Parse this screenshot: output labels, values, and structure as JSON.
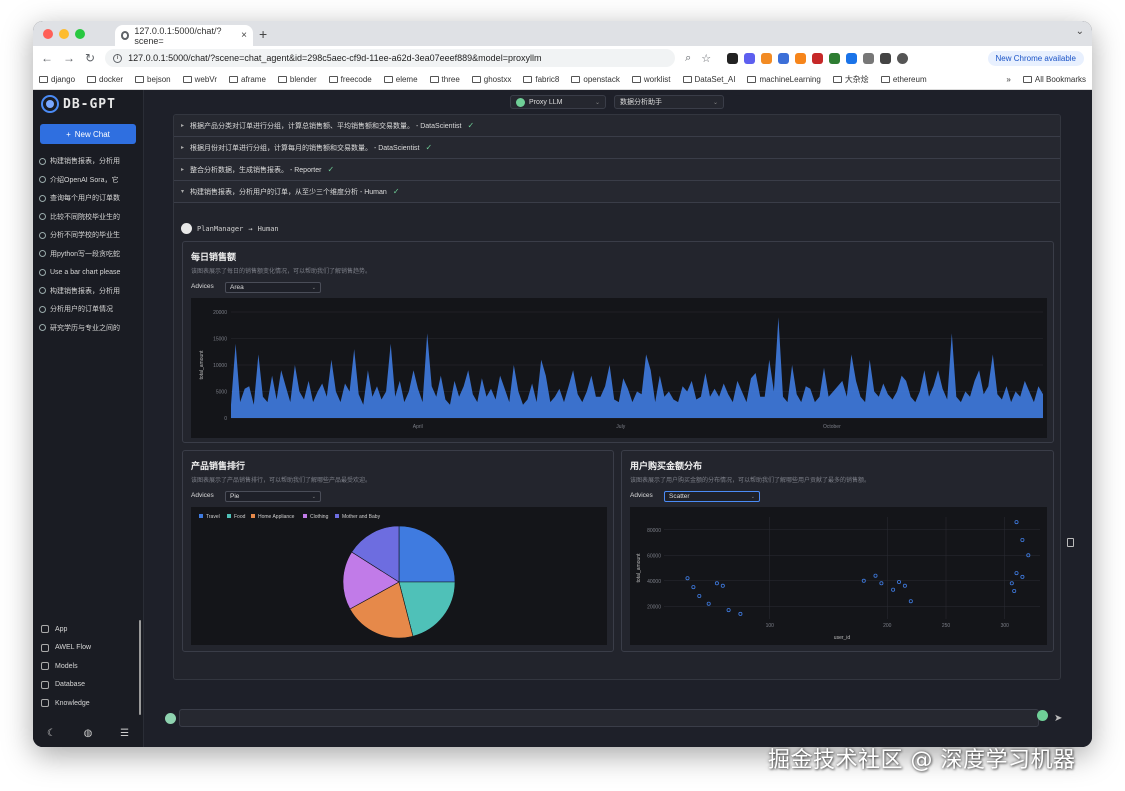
{
  "browser": {
    "tab_title": "127.0.0.1:5000/chat/?scene=",
    "url": "127.0.0.1:5000/chat/?scene=chat_agent&id=298c5aec-cf9d-11ee-a62d-3ea07eeef889&model=proxyllm",
    "update_label": "New Chrome available",
    "bookmarks": [
      "django",
      "docker",
      "bejson",
      "webVr",
      "aframe",
      "blender",
      "freecode",
      "eleme",
      "three",
      "ghostxx",
      "fabric8",
      "openstack",
      "worklist",
      "DataSet_AI",
      "machineLearning",
      "大杂烩",
      "ethereum"
    ],
    "bookmarks_more": "»",
    "all_bookmarks": "All Bookmarks"
  },
  "sidebar": {
    "logo": "DB-GPT",
    "new_chat": "New Chat",
    "conversations": [
      "构建销售报表，分析用",
      "介绍OpenAI Sora，它",
      "查询每个用户的订单数",
      "比较不同院校毕业生的",
      "分析不同学校的毕业生",
      "用python写一段贪吃蛇",
      "Use a bar chart please",
      "构建销售报表，分析用",
      "分析用户的订单情况",
      "研究学历与专业之间的"
    ],
    "bottom_items": [
      "App",
      "AWEL Flow",
      "Models",
      "Database",
      "Knowledge"
    ]
  },
  "top": {
    "model_select": "Proxy LLM",
    "agent_select": "数据分析助手"
  },
  "steps": [
    {
      "text": "根据产品分类对订单进行分组，计算总销售额、平均销售额和交易数量。 - DataScientist",
      "expanded": false
    },
    {
      "text": "根据月份对订单进行分组，计算每月的销售额和交易数量。 - DataScientist",
      "expanded": false
    },
    {
      "text": "整合分析数据，生成销售报表。 - Reporter",
      "expanded": false
    },
    {
      "text": "构建销售报表，分析用户的订单，从至少三个维度分析 - Human",
      "expanded": true
    }
  ],
  "plan": {
    "from": "PlanManager",
    "arrow": "→",
    "to": "Human"
  },
  "cards": {
    "daily": {
      "title": "每日销售额",
      "desc": "该图表展示了每日的销售额变化情况，可以帮助我们了解销售趋势。",
      "advices_label": "Advices",
      "advice": "Area"
    },
    "rank": {
      "title": "产品销售排行",
      "desc": "该图表展示了产品销售排行，可以帮助我们了解哪些产品最受欢迎。",
      "advices_label": "Advices",
      "advice": "Pie"
    },
    "dist": {
      "title": "用户购买金额分布",
      "desc": "该图表展示了用户购买金额的分布情况，可以帮助我们了解哪些用户贡献了最多的销售额。",
      "advices_label": "Advices",
      "advice": "Scatter"
    }
  },
  "chart_data": [
    {
      "type": "area",
      "ylabel": "total_amount",
      "ylim": [
        0,
        20000
      ],
      "yticks": [
        "0",
        "5000",
        "10000",
        "15000",
        "20000"
      ],
      "xticks": [
        "April",
        "July",
        "October"
      ],
      "color": "#3f7be0",
      "values": [
        2500,
        14000,
        3000,
        5500,
        6000,
        2500,
        12000,
        4000,
        3000,
        8000,
        3500,
        9000,
        6000,
        3000,
        10000,
        5000,
        3500,
        7000,
        3000,
        5000,
        6500,
        4000,
        11000,
        5000,
        3000,
        6500,
        5000,
        13000,
        4500,
        2500,
        9000,
        4000,
        6000,
        3500,
        5000,
        14000,
        4000,
        7000,
        3000,
        5000,
        9000,
        5500,
        3000,
        16000,
        6000,
        4000,
        8000,
        3500,
        2500,
        7000,
        4000,
        6000,
        9000,
        4500,
        3000,
        7500,
        4000,
        5500,
        3500,
        8000,
        5500,
        3000,
        10000,
        5000,
        2500,
        3500,
        6500,
        3000,
        11000,
        8000,
        3000,
        4000,
        5500,
        3000,
        6000,
        9000,
        4500,
        3000,
        5000,
        8000,
        4000,
        4000,
        6000,
        10000,
        3500,
        3000,
        7500,
        5500,
        3000,
        5000,
        4500,
        12000,
        9000,
        3000,
        8000,
        4000,
        5000,
        3500,
        3000,
        6000,
        5000,
        7000,
        3500,
        4000,
        8500,
        4000,
        5500,
        4000,
        6500,
        4500,
        3000,
        7000,
        5000,
        3000,
        7500,
        8500,
        4000,
        4000,
        11000,
        5000,
        19000,
        4000,
        3000,
        10000,
        4500,
        3000,
        6000,
        5500,
        3000,
        4000,
        9500,
        4000,
        5000,
        6000,
        7000,
        4000,
        12000,
        7000,
        4000,
        3000,
        11000,
        5000,
        4000,
        6500,
        4500,
        3500,
        5000,
        8000,
        7000,
        4000,
        3000,
        5000,
        9000,
        4000,
        6000,
        9000,
        5500,
        3500,
        16000,
        4000,
        3000,
        5000,
        4000,
        7000,
        9000,
        4500,
        6000,
        12000,
        4500,
        3500,
        6000,
        3000,
        5000,
        4000,
        7000,
        5000,
        3000,
        6000,
        4500
      ]
    },
    {
      "type": "pie",
      "legend": [
        "Travel",
        "Food",
        "Home Appliance",
        "Clothing",
        "Mother and Baby"
      ],
      "values": [
        25,
        21,
        21,
        17,
        16
      ],
      "colors": [
        "#3f7be0",
        "#4fc1b8",
        "#e6894a",
        "#c17be8",
        "#6d6de0"
      ]
    },
    {
      "type": "scatter",
      "xlabel": "user_id",
      "ylabel": "total_amount",
      "xticks": [
        "100",
        "200",
        "250",
        "300"
      ],
      "yticks": [
        "20000",
        "40000",
        "60000",
        "80000"
      ],
      "color": "#3f7be0",
      "points": [
        [
          20,
          42000
        ],
        [
          25,
          35000
        ],
        [
          30,
          28000
        ],
        [
          38,
          22000
        ],
        [
          45,
          38000
        ],
        [
          50,
          36000
        ],
        [
          55,
          17000
        ],
        [
          65,
          14000
        ],
        [
          170,
          40000
        ],
        [
          180,
          44000
        ],
        [
          185,
          38000
        ],
        [
          200,
          39000
        ],
        [
          205,
          36000
        ],
        [
          210,
          24000
        ],
        [
          195,
          33000
        ],
        [
          300,
          86000
        ],
        [
          305,
          72000
        ],
        [
          310,
          60000
        ],
        [
          296,
          38000
        ],
        [
          300,
          46000
        ],
        [
          305,
          43000
        ],
        [
          298,
          32000
        ]
      ]
    }
  ]
}
